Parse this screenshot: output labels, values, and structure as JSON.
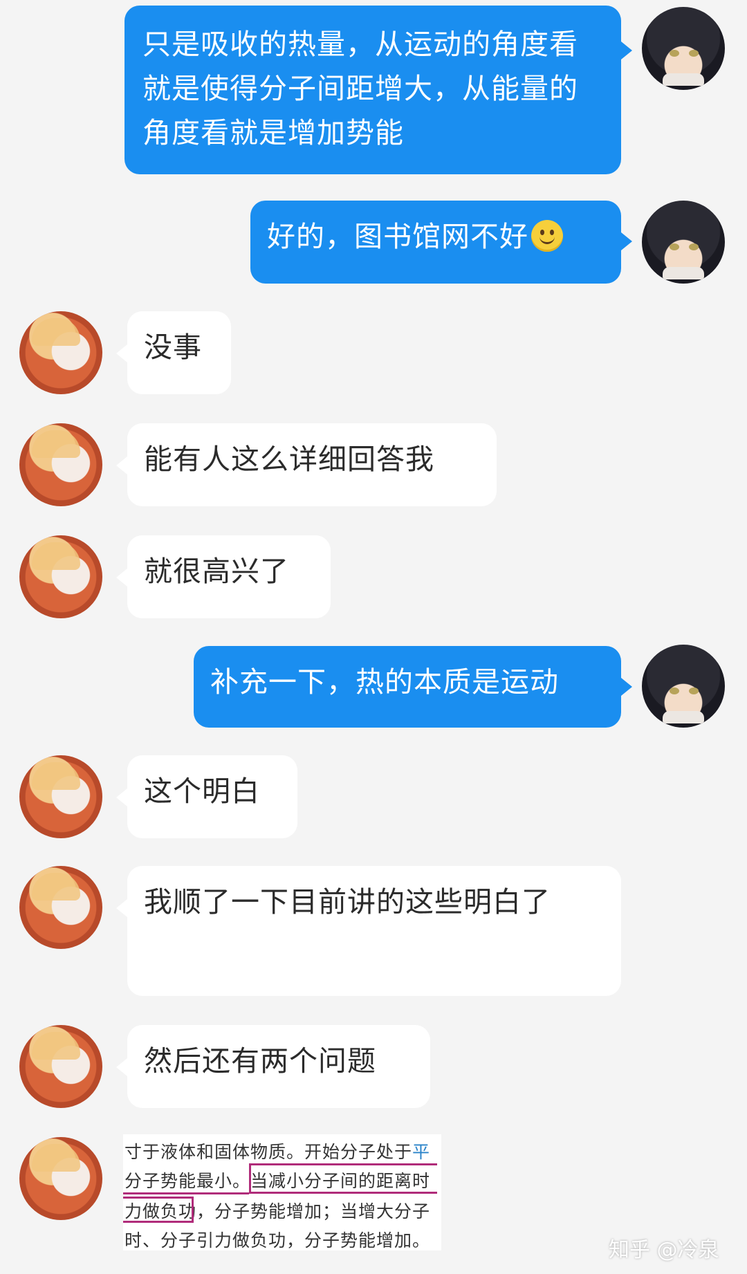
{
  "messages": [
    {
      "from": "me",
      "text": "只是吸收的热量，从运动的角度看就是使得分子间距增大，从能量的角度看就是增加势能"
    },
    {
      "from": "me",
      "text": "好的，图书馆网不好",
      "emoji": "slightly-smiling-face-icon"
    },
    {
      "from": "peer",
      "text": "没事"
    },
    {
      "from": "peer",
      "text": "能有人这么详细回答我"
    },
    {
      "from": "peer",
      "text": "就很高兴了"
    },
    {
      "from": "me",
      "text": "补充一下，热的本质是运动"
    },
    {
      "from": "peer",
      "text": "这个明白"
    },
    {
      "from": "peer",
      "text": "我顺了一下目前讲的这些明白了"
    },
    {
      "from": "peer",
      "text": "然后还有两个问题"
    },
    {
      "from": "peer",
      "type": "image",
      "lines": [
        {
          "pre": "寸于液体和固体物质。开始分子处于",
          "blue": "平"
        },
        {
          "pre": "分子势能最小。当减小分子间的距离时",
          "blue": ""
        },
        {
          "pre": "力做负功，分子势能增加；当增大分子",
          "blue": ""
        },
        {
          "pre": "时、分子引力做负功，分子势能增加。",
          "blue": ""
        }
      ]
    }
  ],
  "watermark": "知乎 @冷泉",
  "colors": {
    "me_bubble": "#1a8ef0",
    "peer_bubble": "#ffffff",
    "background": "#f4f4f4",
    "highlight_box": "#b02c7a"
  }
}
